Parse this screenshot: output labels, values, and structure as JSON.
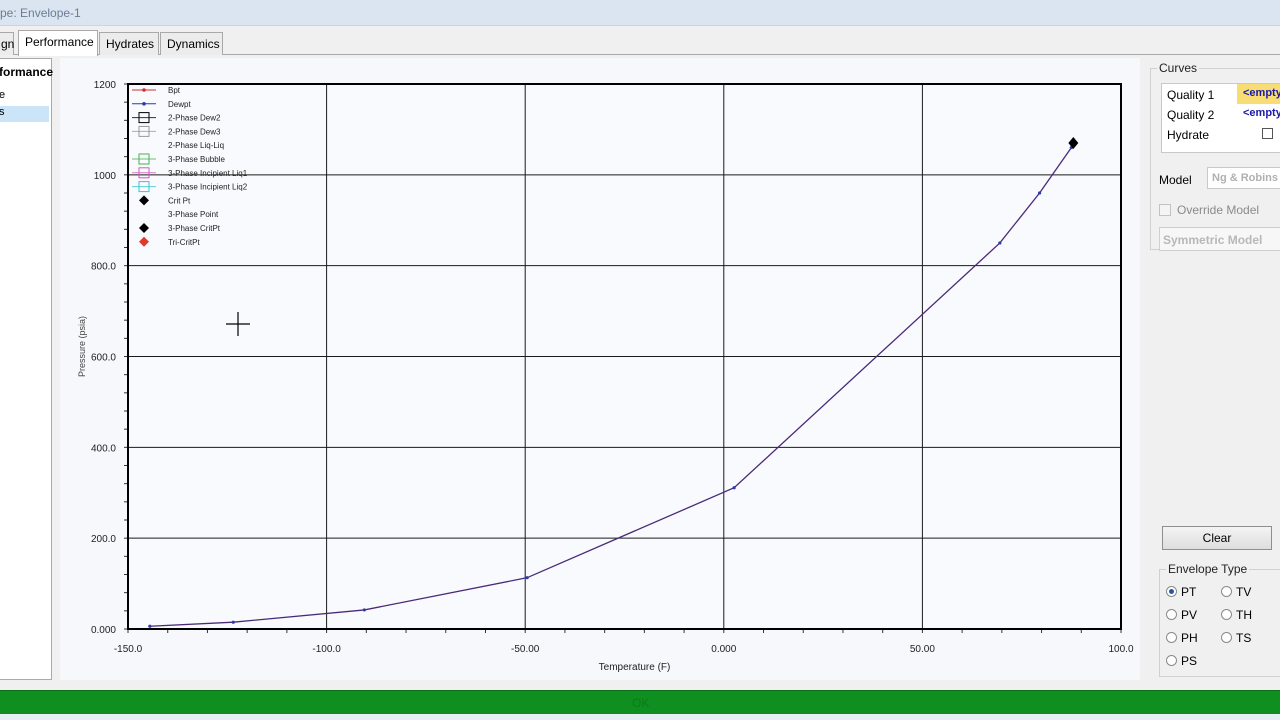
{
  "window": {
    "title": "pe: Envelope-1"
  },
  "tabs": [
    {
      "label": "gn",
      "active": false
    },
    {
      "label": "Performance",
      "active": true
    },
    {
      "label": "Hydrates",
      "active": false
    },
    {
      "label": "Dynamics",
      "active": false
    }
  ],
  "left_panel": {
    "header": "formance",
    "items": [
      {
        "label": "e",
        "selected": false
      },
      {
        "label": "s",
        "selected": true
      }
    ]
  },
  "right_panel": {
    "curves_title": "Curves",
    "curves": [
      {
        "label": "Quality 1",
        "value": "<empty"
      },
      {
        "label": "Quality 2",
        "value": "<empty"
      },
      {
        "label": "Hydrate",
        "value": ""
      }
    ],
    "model_label": "Model",
    "model_value": "Ng & Robins",
    "override_label": "Override Model",
    "symmetric_label": "Symmetric Model",
    "clear_label": "Clear",
    "envelope_type_title": "Envelope Type",
    "envelope_types": [
      {
        "label": "PT",
        "selected": true
      },
      {
        "label": "TV",
        "selected": false
      },
      {
        "label": "PV",
        "selected": false
      },
      {
        "label": "TH",
        "selected": false
      },
      {
        "label": "PH",
        "selected": false
      },
      {
        "label": "TS",
        "selected": false
      },
      {
        "label": "PS",
        "selected": false
      }
    ]
  },
  "status": {
    "text": "OK"
  },
  "chart_data": {
    "type": "line",
    "xlabel": "Temperature (F)",
    "ylabel": "Pressure (psia)",
    "xlim": [
      -150,
      100
    ],
    "ylim": [
      0,
      1200
    ],
    "x_ticks": [
      "-150.0",
      "-100.0",
      "-50.00",
      "0.000",
      "50.00",
      "100.0"
    ],
    "y_ticks": [
      "0.000",
      "200.0",
      "400.0",
      "600.0",
      "800.0",
      "1000",
      "1200"
    ],
    "grid": true,
    "legend_position": "top-left",
    "legend": [
      {
        "name": "Bpt",
        "color": "#d0302f",
        "marker": "line-dot"
      },
      {
        "name": "Dewpt",
        "color": "#2d3ba8",
        "marker": "line-dot"
      },
      {
        "name": "2-Phase Dew2",
        "color": "#000000",
        "marker": "square"
      },
      {
        "name": "2-Phase Dew3",
        "color": "#9a9a9a",
        "marker": "square"
      },
      {
        "name": "2-Phase Liq-Liq",
        "color": "#ffffff",
        "marker": "none"
      },
      {
        "name": "3-Phase Bubble",
        "color": "#4caf50",
        "marker": "square"
      },
      {
        "name": "3-Phase Incipient Liq1",
        "color": "#d257c4",
        "marker": "square"
      },
      {
        "name": "3-Phase Incipient Liq2",
        "color": "#39c4d6",
        "marker": "square"
      },
      {
        "name": "Crit Pt",
        "color": "#000000",
        "marker": "diamond"
      },
      {
        "name": "3-Phase Point",
        "color": "#ffffff",
        "marker": "none"
      },
      {
        "name": "3-Phase CritPt",
        "color": "#000000",
        "marker": "diamond"
      },
      {
        "name": "Tri-CritPt",
        "color": "#e23a2a",
        "marker": "diamond"
      }
    ],
    "series": [
      {
        "name": "Dewpt",
        "color": "#4a2a78",
        "x": [
          -144.5,
          -123.5,
          -90.5,
          -49.5,
          2.6,
          69.5,
          79.5,
          87.5
        ],
        "y": [
          6,
          15,
          42,
          113,
          311,
          850,
          960,
          1060
        ]
      }
    ],
    "points": [
      {
        "name": "Crit Pt",
        "x": 88,
        "y": 1070
      }
    ]
  }
}
